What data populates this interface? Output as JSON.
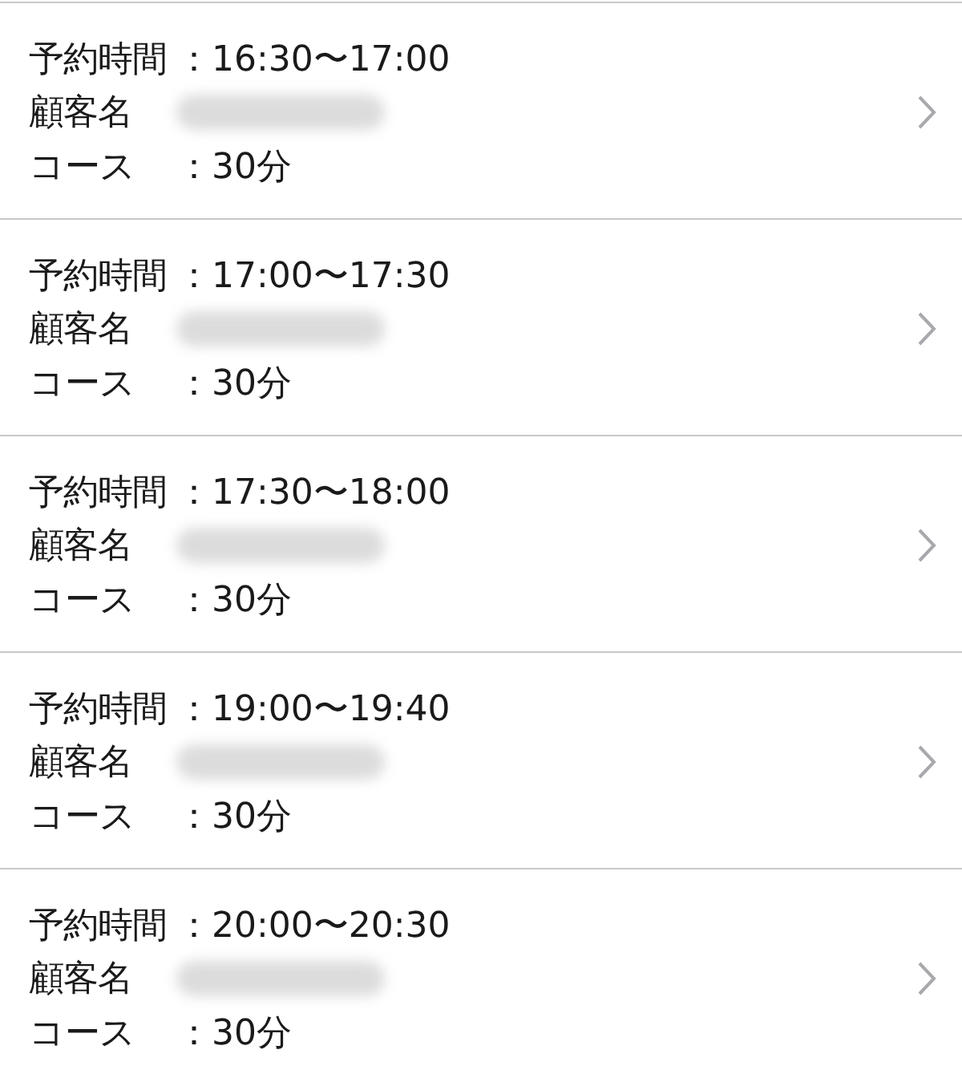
{
  "reservations": [
    {
      "time_label": "予約時間",
      "time": "：16:30〜17:00",
      "customer_label": "顧客名",
      "course_label": "コース",
      "course": "：30分"
    },
    {
      "time_label": "予約時間",
      "time": "：17:00〜17:30",
      "customer_label": "顧客名",
      "course_label": "コース",
      "course": "：30分"
    },
    {
      "time_label": "予約時間",
      "time": "：17:30〜18:00",
      "customer_label": "顧客名",
      "course_label": "コース",
      "course": "：30分"
    },
    {
      "time_label": "予約時間",
      "time": "：19:00〜19:40",
      "customer_label": "顧客名",
      "course_label": "コース",
      "course": "：30分"
    },
    {
      "time_label": "予約時間",
      "time": "：20:00〜20:30",
      "customer_label": "顧客名",
      "course_label": "コース",
      "course": "：30分"
    }
  ]
}
